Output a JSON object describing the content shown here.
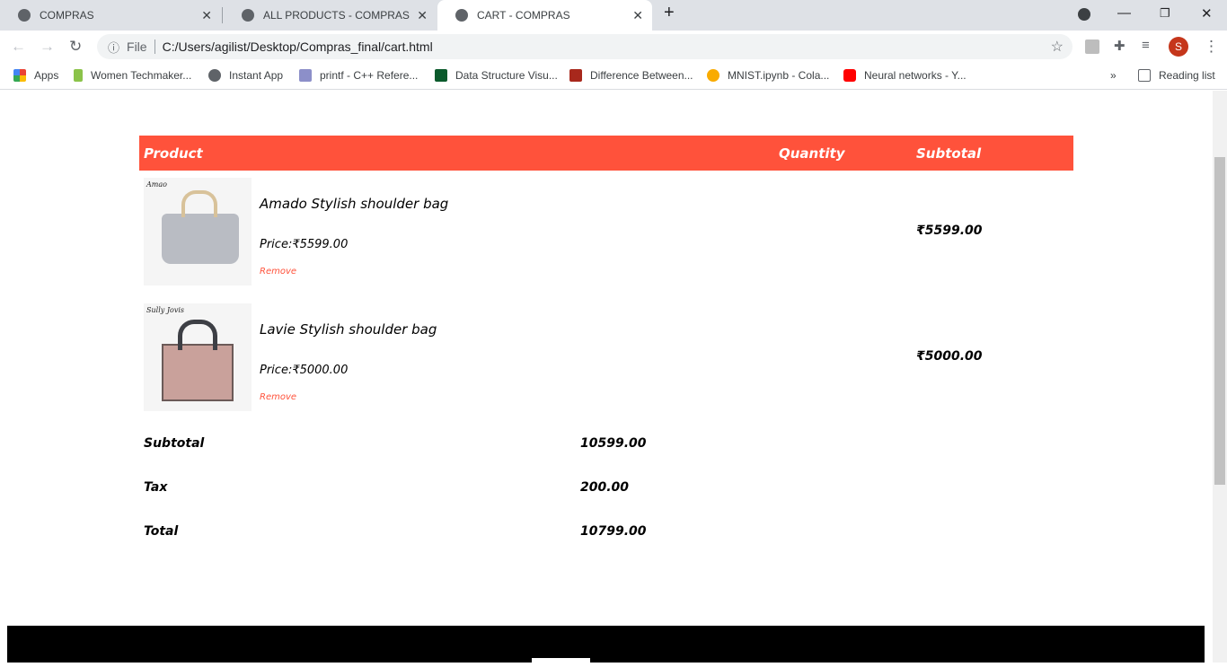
{
  "browser": {
    "tabs": [
      {
        "label": "COMPRAS"
      },
      {
        "label": "ALL PRODUCTS - COMPRAS"
      },
      {
        "label": "CART - COMPRAS",
        "active": true
      }
    ],
    "address": {
      "scheme": "File",
      "url": "C:/Users/agilist/Desktop/Compras_final/cart.html"
    },
    "profile_initial": "S",
    "bookmarks": [
      {
        "label": "Apps",
        "icon": "apps-grid-icon"
      },
      {
        "label": "Women Techmaker...",
        "icon": "techmakers-icon"
      },
      {
        "label": "Instant App",
        "icon": "globe-icon"
      },
      {
        "label": "printf - C++ Refere...",
        "icon": "cplusplus-icon"
      },
      {
        "label": "Data Structure Visu...",
        "icon": "usf-icon"
      },
      {
        "label": "Difference Between...",
        "icon": "td-icon"
      },
      {
        "label": "MNIST.ipynb - Cola...",
        "icon": "colab-icon"
      },
      {
        "label": "Neural networks - Y...",
        "icon": "youtube-icon"
      }
    ],
    "reading_list": "Reading list"
  },
  "cart": {
    "headers": {
      "product": "Product",
      "quantity": "Quantity",
      "subtotal": "Subtotal"
    },
    "items": [
      {
        "name": "Amado Stylish shoulder bag",
        "price": "Price:₹5599.00",
        "remove": "Remove",
        "subtotal": "₹5599.00",
        "brand": "Amao",
        "color": "#b9bcc3"
      },
      {
        "name": "Lavie Stylish shoulder bag",
        "price": "Price:₹5000.00",
        "remove": "Remove",
        "subtotal": "₹5000.00",
        "brand": "Sully Jovis",
        "color": "#c9a19b"
      }
    ],
    "summary": [
      {
        "label": "Subtotal",
        "value": "10599.00"
      },
      {
        "label": "Tax",
        "value": "200.00"
      },
      {
        "label": "Total",
        "value": "10799.00"
      }
    ]
  },
  "colors": {
    "accent": "#ff523b",
    "footer": "#000000"
  }
}
